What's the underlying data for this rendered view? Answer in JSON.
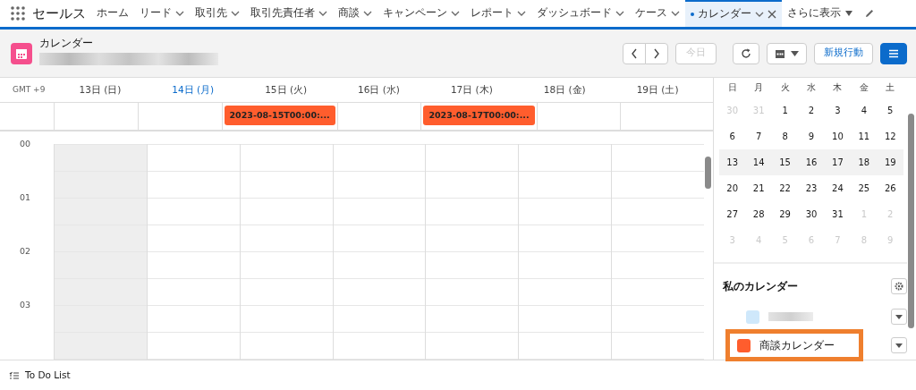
{
  "app": {
    "name": "セールス"
  },
  "nav_tabs": [
    {
      "label": "ホーム",
      "has_menu": false,
      "selected": false,
      "modified": false,
      "closable": false
    },
    {
      "label": "リード",
      "has_menu": true,
      "selected": false,
      "modified": false,
      "closable": false
    },
    {
      "label": "取引先",
      "has_menu": true,
      "selected": false,
      "modified": false,
      "closable": false
    },
    {
      "label": "取引先責任者",
      "has_menu": true,
      "selected": false,
      "modified": false,
      "closable": false
    },
    {
      "label": "商談",
      "has_menu": true,
      "selected": false,
      "modified": false,
      "closable": false
    },
    {
      "label": "キャンペーン",
      "has_menu": true,
      "selected": false,
      "modified": false,
      "closable": false
    },
    {
      "label": "レポート",
      "has_menu": true,
      "selected": false,
      "modified": false,
      "closable": false
    },
    {
      "label": "ダッシュボード",
      "has_menu": true,
      "selected": false,
      "modified": false,
      "closable": false
    },
    {
      "label": "ケース",
      "has_menu": true,
      "selected": false,
      "modified": false,
      "closable": false
    },
    {
      "label": "カレンダー",
      "has_menu": true,
      "selected": true,
      "modified": true,
      "closable": true
    }
  ],
  "more_menu": {
    "label": "さらに表示"
  },
  "header": {
    "title": "カレンダー",
    "today_button": {
      "label": "今日",
      "disabled": true
    },
    "new_event_button": {
      "label": "新規行動"
    },
    "list_view_selected": true
  },
  "timezone": "GMT +9",
  "days": [
    {
      "label": "13日 (日)",
      "today": false,
      "shaded": true
    },
    {
      "label": "14日 (月)",
      "today": true,
      "shaded": false
    },
    {
      "label": "15日 (火)",
      "today": false,
      "shaded": false,
      "all_day_events": [
        {
          "title": "2023-08-15T00:00:...",
          "color": "#ff5d2d"
        }
      ]
    },
    {
      "label": "16日 (水)",
      "today": false,
      "shaded": false
    },
    {
      "label": "17日 (木)",
      "today": false,
      "shaded": false,
      "all_day_events": [
        {
          "title": "2023-08-17T00:00:...",
          "color": "#ff5d2d"
        }
      ]
    },
    {
      "label": "18日 (金)",
      "today": false,
      "shaded": false
    },
    {
      "label": "19日 (土)",
      "today": false,
      "shaded": false
    }
  ],
  "hours": [
    "00",
    "01",
    "02",
    "03"
  ],
  "mini_calendar": {
    "weekdays": [
      "日",
      "月",
      "火",
      "水",
      "木",
      "金",
      "土"
    ],
    "weeks": [
      {
        "selected": false,
        "days": [
          {
            "label": "30",
            "other_month": true
          },
          {
            "label": "31",
            "other_month": true
          },
          {
            "label": "1",
            "other_month": false
          },
          {
            "label": "2",
            "other_month": false
          },
          {
            "label": "3",
            "other_month": false
          },
          {
            "label": "4",
            "other_month": false
          },
          {
            "label": "5",
            "other_month": false
          }
        ]
      },
      {
        "selected": false,
        "days": [
          {
            "label": "6",
            "other_month": false
          },
          {
            "label": "7",
            "other_month": false
          },
          {
            "label": "8",
            "other_month": false
          },
          {
            "label": "9",
            "other_month": false
          },
          {
            "label": "10",
            "other_month": false
          },
          {
            "label": "11",
            "other_month": false
          },
          {
            "label": "12",
            "other_month": false
          }
        ]
      },
      {
        "selected": true,
        "days": [
          {
            "label": "13",
            "other_month": false
          },
          {
            "label": "14",
            "other_month": false
          },
          {
            "label": "15",
            "other_month": false
          },
          {
            "label": "16",
            "other_month": false
          },
          {
            "label": "17",
            "other_month": false
          },
          {
            "label": "18",
            "other_month": false
          },
          {
            "label": "19",
            "other_month": false
          }
        ]
      },
      {
        "selected": false,
        "days": [
          {
            "label": "20",
            "other_month": false
          },
          {
            "label": "21",
            "other_month": false
          },
          {
            "label": "22",
            "other_month": false
          },
          {
            "label": "23",
            "other_month": false
          },
          {
            "label": "24",
            "other_month": false
          },
          {
            "label": "25",
            "other_month": false
          },
          {
            "label": "26",
            "other_month": false
          }
        ]
      },
      {
        "selected": false,
        "days": [
          {
            "label": "27",
            "other_month": false
          },
          {
            "label": "28",
            "other_month": false
          },
          {
            "label": "29",
            "other_month": false
          },
          {
            "label": "30",
            "other_month": false
          },
          {
            "label": "31",
            "other_month": false
          },
          {
            "label": "1",
            "other_month": true
          },
          {
            "label": "2",
            "other_month": true
          }
        ]
      },
      {
        "selected": false,
        "days": [
          {
            "label": "3",
            "other_month": true
          },
          {
            "label": "4",
            "other_month": true
          },
          {
            "label": "5",
            "other_month": true
          },
          {
            "label": "6",
            "other_month": true
          },
          {
            "label": "7",
            "other_month": true
          },
          {
            "label": "8",
            "other_month": true
          },
          {
            "label": "9",
            "other_month": true
          }
        ]
      }
    ]
  },
  "my_calendars": {
    "title": "私のカレンダー",
    "items": [
      {
        "color": "#cfe8fb",
        "highlighted": false
      },
      {
        "name": "商談カレンダー",
        "color": "#ff5d2d",
        "highlighted": true
      }
    ]
  },
  "footer": {
    "label": "To Do List"
  }
}
